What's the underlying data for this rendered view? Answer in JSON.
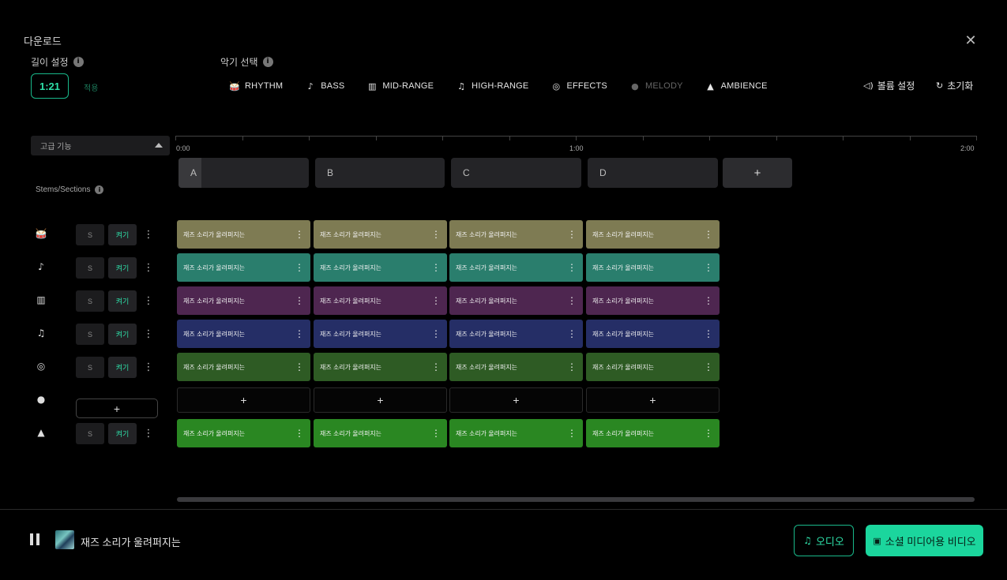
{
  "header": {
    "title": "다운로드"
  },
  "length": {
    "label": "길이 설정",
    "value": "1:21",
    "apply": "적용"
  },
  "instrument": {
    "label": "악기 선택",
    "items": [
      {
        "label": "RHYTHM",
        "icon": "drum-icon",
        "glyph": "🥁",
        "disabled": false
      },
      {
        "label": "BASS",
        "icon": "tuba-icon",
        "glyph": "♪",
        "disabled": false
      },
      {
        "label": "MID-RANGE",
        "icon": "piano-icon",
        "glyph": "▥",
        "disabled": false
      },
      {
        "label": "HIGH-RANGE",
        "icon": "guitar-icon",
        "glyph": "♫",
        "disabled": false
      },
      {
        "label": "EFFECTS",
        "icon": "effects-icon",
        "glyph": "◎",
        "disabled": false
      },
      {
        "label": "MELODY",
        "icon": "microphone-icon",
        "glyph": "●",
        "disabled": true
      },
      {
        "label": "AMBIENCE",
        "icon": "mountain-icon",
        "glyph": "▲",
        "disabled": false
      }
    ]
  },
  "controls": {
    "volume": "볼륨 설정",
    "reset": "초기화"
  },
  "advanced": {
    "label": "고급 기능"
  },
  "timeline": {
    "ticks": [
      "0:00",
      "1:00",
      "2:00"
    ]
  },
  "sections": {
    "items": [
      "A",
      "B",
      "C",
      "D"
    ],
    "add": "+"
  },
  "stems": {
    "label": "Stems/Sections",
    "solo": "S",
    "on": "켜기",
    "add": "+",
    "clip_text": "재즈 소리가 울려퍼지는",
    "tracks": [
      {
        "icon": "drum-icon",
        "glyph": "🥁",
        "color": "#7e7b53",
        "empty": false
      },
      {
        "icon": "tuba-icon",
        "glyph": "♪",
        "color": "#2a7e6d",
        "empty": false
      },
      {
        "icon": "piano-icon",
        "glyph": "▥",
        "color": "#4e2650",
        "empty": false
      },
      {
        "icon": "guitar-icon",
        "glyph": "♫",
        "color": "#252e66",
        "empty": false
      },
      {
        "icon": "effects-icon",
        "glyph": "◎",
        "color": "#2e5b24",
        "empty": false
      },
      {
        "icon": "microphone-icon",
        "glyph": "●",
        "color": "#000000",
        "empty": true
      },
      {
        "icon": "mountain-icon",
        "glyph": "▲",
        "color": "#2a8722",
        "empty": false
      }
    ]
  },
  "player": {
    "song": "재즈 소리가 울려퍼지는"
  },
  "actions": {
    "audio": "오디오",
    "video": "소셜 미디어용 비디오"
  },
  "colors": {
    "accent": "#1bd69d",
    "background": "#000000"
  }
}
